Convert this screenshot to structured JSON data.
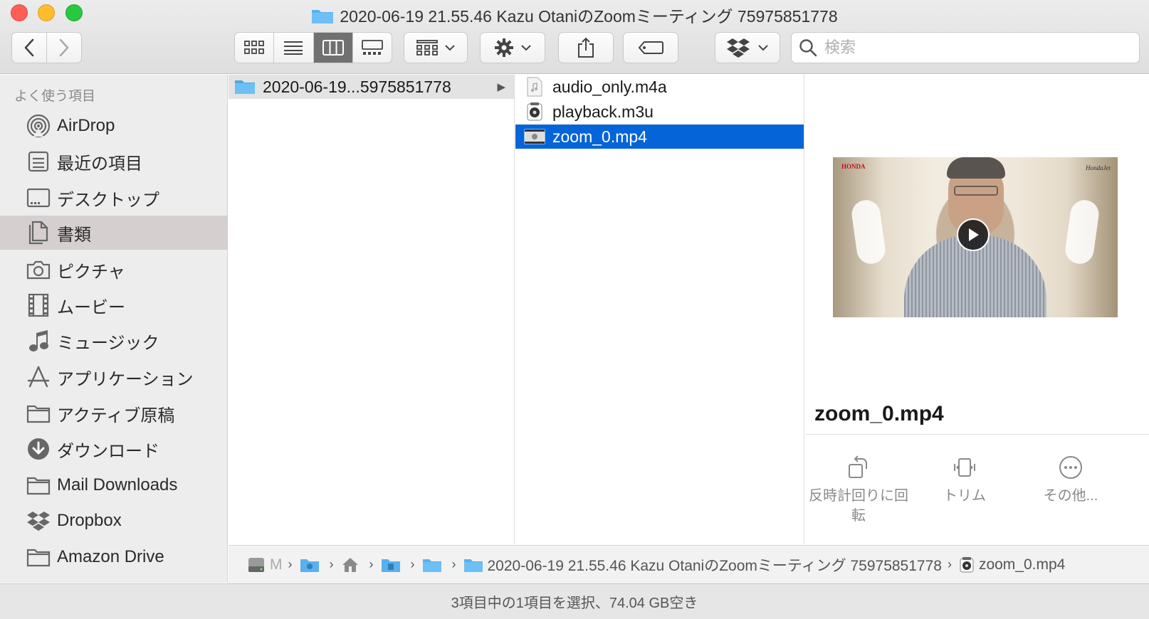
{
  "window": {
    "title": "2020-06-19 21.55.46 Kazu OtaniのZoomミーティング 75975851778"
  },
  "toolbar": {
    "back_icon": "chevron-left-icon",
    "forward_icon": "chevron-right-icon",
    "view_modes": [
      "icon",
      "list",
      "column",
      "gallery"
    ],
    "active_view": "column",
    "search_placeholder": "検索"
  },
  "sidebar": {
    "heading": "よく使う項目",
    "items": [
      {
        "label": "AirDrop",
        "icon": "airdrop-icon"
      },
      {
        "label": "最近の項目",
        "icon": "recents-icon"
      },
      {
        "label": "デスクトップ",
        "icon": "desktop-icon"
      },
      {
        "label": "書類",
        "icon": "documents-icon",
        "active": true
      },
      {
        "label": "ピクチャ",
        "icon": "camera-icon"
      },
      {
        "label": "ムービー",
        "icon": "film-icon"
      },
      {
        "label": "ミュージック",
        "icon": "music-note-icon"
      },
      {
        "label": "アプリケーション",
        "icon": "applications-icon"
      },
      {
        "label": "アクティブ原稿",
        "icon": "folder-icon"
      },
      {
        "label": "ダウンロード",
        "icon": "download-icon"
      },
      {
        "label": "Mail Downloads",
        "icon": "folder-icon"
      },
      {
        "label": "Dropbox",
        "icon": "dropbox-icon"
      },
      {
        "label": "Amazon Drive",
        "icon": "folder-icon"
      }
    ]
  },
  "columns": {
    "col1": [
      {
        "label": "2020-06-19...5975851778",
        "icon": "folder-icon"
      }
    ],
    "col2": [
      {
        "label": "audio_only.m4a",
        "icon": "audio-file-icon"
      },
      {
        "label": "playback.m3u",
        "icon": "playlist-file-icon"
      },
      {
        "label": "zoom_0.mp4",
        "icon": "video-file-icon",
        "selected": true
      }
    ]
  },
  "preview": {
    "thumb_brand_left": "HONDA",
    "thumb_brand_right": "HondaJet",
    "file_name": "zoom_0.mp4",
    "actions": [
      {
        "label": "反時計回りに回転",
        "icon": "rotate-left-icon"
      },
      {
        "label": "トリム",
        "icon": "trim-icon"
      },
      {
        "label": "その他...",
        "icon": "more-icon"
      }
    ]
  },
  "pathbar": {
    "drive_label": "M",
    "folder_label": "2020-06-19 21.55.46 Kazu OtaniのZoomミーティング 75975851778",
    "file_label": "zoom_0.mp4"
  },
  "status": {
    "text": "3項目中の1項目を選択、74.04 GB空き"
  },
  "colors": {
    "selection": "#0564d8",
    "folder": "#5ab0ec",
    "sidebar_active": "#d6cfcf"
  }
}
